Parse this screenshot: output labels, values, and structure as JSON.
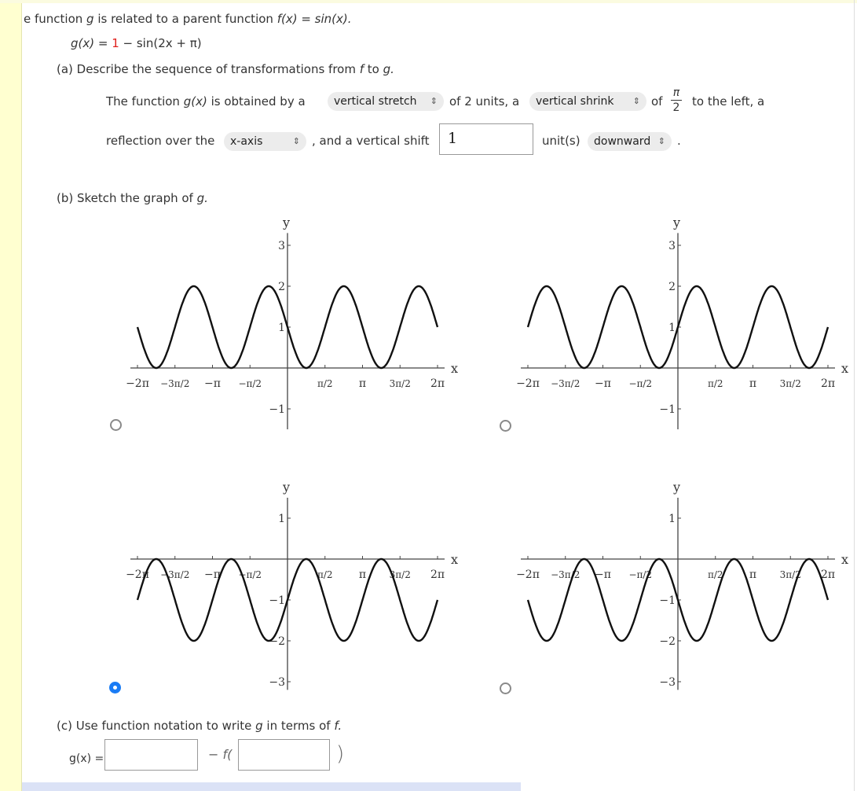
{
  "intro": {
    "prefix": "e function ",
    "g": "g",
    "mid": " is related to a parent function ",
    "fx": "f(x) = sin(x)."
  },
  "equation": {
    "lhs": "g(x) = ",
    "constant": "1",
    "rest": " − sin(2x + π)"
  },
  "part_a": {
    "label": "(a) Describe the sequence of transformations from ",
    "f": "f",
    "to": " to ",
    "g": "g.",
    "row1_start": "The function ",
    "gx": "g(x)",
    "row1_mid": " is obtained by a",
    "select1": "vertical stretch",
    "of_units": "of 2 units, a",
    "select2": "vertical shrink",
    "of": "of",
    "frac_num": "π",
    "frac_den": "2",
    "to_left": "to the left, a",
    "row2_start": "reflection over the",
    "select3": "x-axis",
    "and_shift": ", and a vertical shift",
    "shift_value": "1",
    "units": "unit(s)",
    "select4": "downward",
    "period": "."
  },
  "part_b": {
    "label": "(b) Sketch the graph of ",
    "g": "g."
  },
  "part_c": {
    "label": "(c) Use function notation to write ",
    "g": "g",
    " in_terms": " in terms of ",
    "f": "f.",
    "lhs": "g(x) =",
    "minus_f": "− f(",
    "close": ")",
    "input1": "",
    "input2": ""
  },
  "accent": "#1a7cf5",
  "chart_data": [
    {
      "type": "line",
      "function": "y = 1 − sin(2x)",
      "amplitude": -1,
      "frequency": 2,
      "vertical_shift": 1,
      "xlim": [
        "-2π",
        "2π"
      ],
      "ylim": [
        -1.5,
        3.3
      ],
      "xlabel": "x",
      "ylabel": "y",
      "x_ticks": [
        "−2π",
        "−3π/2",
        "−π",
        "−π/2",
        "π/2",
        "π",
        "3π/2",
        "2π"
      ],
      "y_ticks": [
        "3",
        "2",
        "1",
        "−1"
      ],
      "selected": false
    },
    {
      "type": "line",
      "function": "y = 1 + sin(2x)",
      "amplitude": 1,
      "frequency": 2,
      "vertical_shift": 1,
      "xlim": [
        "-2π",
        "2π"
      ],
      "ylim": [
        -1.5,
        3.3
      ],
      "xlabel": "x",
      "ylabel": "y",
      "x_ticks": [
        "−2π",
        "−3π/2",
        "−π",
        "−π/2",
        "π/2",
        "π",
        "3π/2",
        "2π"
      ],
      "y_ticks": [
        "3",
        "2",
        "1",
        "−1"
      ],
      "selected": false
    },
    {
      "type": "line",
      "function": "y = −1 + sin(2x)",
      "amplitude": 1,
      "frequency": 2,
      "vertical_shift": -1,
      "xlim": [
        "-2π",
        "2π"
      ],
      "ylim": [
        -3.2,
        1.5
      ],
      "xlabel": "x",
      "ylabel": "y",
      "x_ticks": [
        "−2π",
        "−3π/2",
        "−π",
        "−π/2",
        "π/2",
        "π",
        "3π/2",
        "2π"
      ],
      "y_ticks": [
        "1",
        "−1",
        "−2",
        "−3"
      ],
      "selected": true
    },
    {
      "type": "line",
      "function": "y = −1 − sin(2x)",
      "amplitude": -1,
      "frequency": 2,
      "vertical_shift": -1,
      "xlim": [
        "-2π",
        "2π"
      ],
      "ylim": [
        -3.2,
        1.5
      ],
      "xlabel": "x",
      "ylabel": "y",
      "x_ticks": [
        "−2π",
        "−3π/2",
        "−π",
        "−π/2",
        "π/2",
        "π",
        "3π/2",
        "2π"
      ],
      "y_ticks": [
        "1",
        "−1",
        "−2",
        "−3"
      ],
      "selected": false
    }
  ]
}
